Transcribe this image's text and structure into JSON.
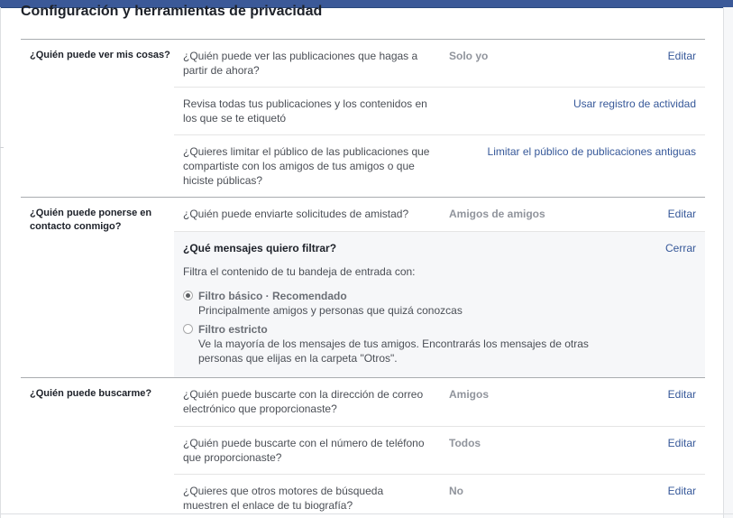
{
  "page": {
    "title": "Configuración y herramientas de privacidad"
  },
  "sections": [
    {
      "label": "¿Quién puede ver mis cosas?",
      "rows": [
        {
          "question": "¿Quién puede ver las publicaciones que hagas a partir de ahora?",
          "value": "Solo yo",
          "action": "Editar"
        },
        {
          "question": "Revisa todas tus publicaciones y los contenidos en los que se te etiquetó",
          "value": "",
          "action": "Usar registro de actividad"
        },
        {
          "question": "¿Quieres limitar el público de las publicaciones que compartiste con los amigos de tus amigos o que hiciste públicas?",
          "value": "",
          "action": "Limitar el público de publicaciones antiguas"
        }
      ]
    },
    {
      "label": "¿Quién puede ponerse en contacto conmigo?",
      "rows": [
        {
          "question": "¿Quién puede enviarte solicitudes de amistad?",
          "value": "Amigos de amigos",
          "action": "Editar"
        }
      ],
      "expanded": {
        "title": "¿Qué mensajes quiero filtrar?",
        "action": "Cerrar",
        "subtitle": "Filtra el contenido de tu bandeja de entrada con:",
        "options": [
          {
            "title": "Filtro básico · Recomendado",
            "description": "Principalmente amigos y personas que quizá conozcas",
            "selected": true
          },
          {
            "title": "Filtro estricto",
            "description": "Ve la mayoría de los mensajes de tus amigos. Encontrarás los mensajes de otras personas que elijas en la carpeta \"Otros\".",
            "selected": false
          }
        ]
      }
    },
    {
      "label": "¿Quién puede buscarme?",
      "rows": [
        {
          "question": "¿Quién puede buscarte con la dirección de correo electrónico que proporcionaste?",
          "value": "Amigos",
          "action": "Editar"
        },
        {
          "question": "¿Quién puede buscarte con el número de teléfono que proporcionaste?",
          "value": "Todos",
          "action": "Editar"
        },
        {
          "question": "¿Quieres que otros motores de búsqueda muestren el enlace de tu biografía?",
          "value": "No",
          "action": "Editar"
        }
      ]
    }
  ],
  "colors": {
    "link": "#365899",
    "header_bar": "#3b5998",
    "expanded_bg": "#f6f7f9"
  }
}
